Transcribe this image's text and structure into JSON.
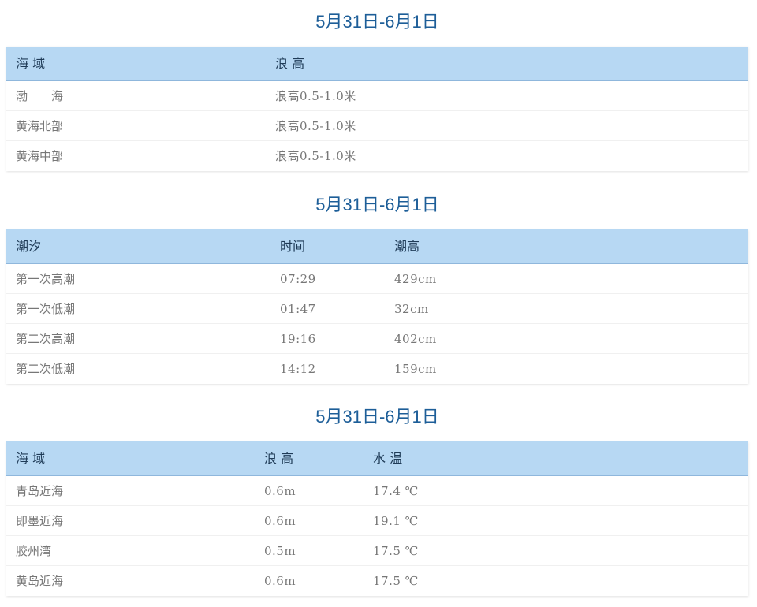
{
  "wave": {
    "title": "5月31日-6月1日",
    "headers": [
      "海 域",
      "浪 高"
    ],
    "rows": [
      [
        "渤　　海",
        "浪高0.5-1.0米"
      ],
      [
        "黄海北部",
        "浪高0.5-1.0米"
      ],
      [
        "黄海中部",
        "浪高0.5-1.0米"
      ]
    ]
  },
  "tide": {
    "title": "5月31日-6月1日",
    "headers": [
      "潮汐",
      "时间",
      "潮高"
    ],
    "rows": [
      [
        "第一次高潮",
        "07:29",
        "429cm"
      ],
      [
        "第一次低潮",
        "01:47",
        "32cm"
      ],
      [
        "第二次高潮",
        "19:16",
        "402cm"
      ],
      [
        "第二次低潮",
        "14:12",
        "159cm"
      ]
    ]
  },
  "coastal": {
    "title": "5月31日-6月1日",
    "headers": [
      "海 域",
      "浪 高",
      "水 温"
    ],
    "rows": [
      [
        "青岛近海",
        "0.6m",
        "17.4 ℃"
      ],
      [
        "即墨近海",
        "0.6m",
        "19.1 ℃"
      ],
      [
        "胶州湾",
        "0.5m",
        "17.5 ℃"
      ],
      [
        "黄岛近海",
        "0.6m",
        "17.5 ℃"
      ]
    ]
  }
}
